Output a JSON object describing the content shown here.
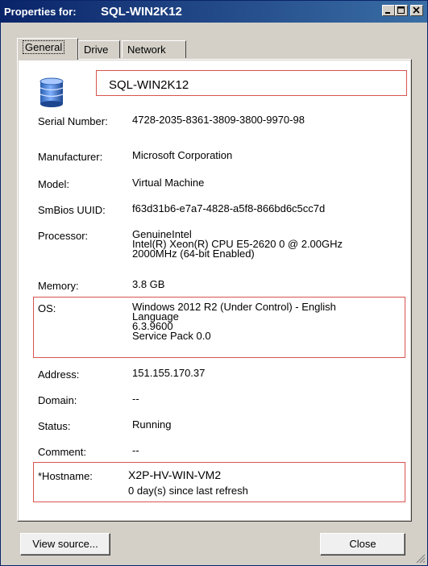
{
  "window": {
    "title_prefix": "Properties for:",
    "title_name": "SQL-WIN2K12"
  },
  "tabs": [
    {
      "label": "General",
      "active": true
    },
    {
      "label": "Drive",
      "active": false
    },
    {
      "label": "Network",
      "active": false
    }
  ],
  "general": {
    "computer_name": "SQL-WIN2K12",
    "fields": {
      "serial_number": {
        "label": "Serial Number:",
        "value": "4728-2035-8361-3809-3800-9970-98"
      },
      "manufacturer": {
        "label": "Manufacturer:",
        "value": "Microsoft Corporation"
      },
      "model": {
        "label": "Model:",
        "value": "Virtual Machine"
      },
      "smbios_uuid": {
        "label": "SmBios UUID:",
        "value": "f63d31b6-e7a7-4828-a5f8-866bd6c5cc7d"
      },
      "processor": {
        "label": "Processor:",
        "value": "GenuineIntel\nIntel(R) Xeon(R) CPU E5-2620 0 @ 2.00GHz\n2000MHz  (64-bit Enabled)"
      },
      "memory": {
        "label": "Memory:",
        "value": "3.8 GB"
      },
      "os": {
        "label": "OS:",
        "value": "Windows 2012 R2 (Under Control)   - English\nLanguage\n 6.3.9600\nService Pack 0.0"
      },
      "address": {
        "label": "Address:",
        "value": "151.155.170.37"
      },
      "domain": {
        "label": "Domain:",
        "value": "--"
      },
      "status": {
        "label": "Status:",
        "value": "Running"
      },
      "comment": {
        "label": "Comment:",
        "value": "--"
      },
      "hostname": {
        "label": "*Hostname:",
        "value": "X2P-HV-WIN-VM2",
        "refresh": "0 day(s) since last refresh"
      }
    }
  },
  "buttons": {
    "view_source": "View source...",
    "close": "Close"
  },
  "colors": {
    "highlight_box": "#d9534f",
    "titlebar_start": "#0a246a",
    "titlebar_end": "#3a6ea5"
  }
}
